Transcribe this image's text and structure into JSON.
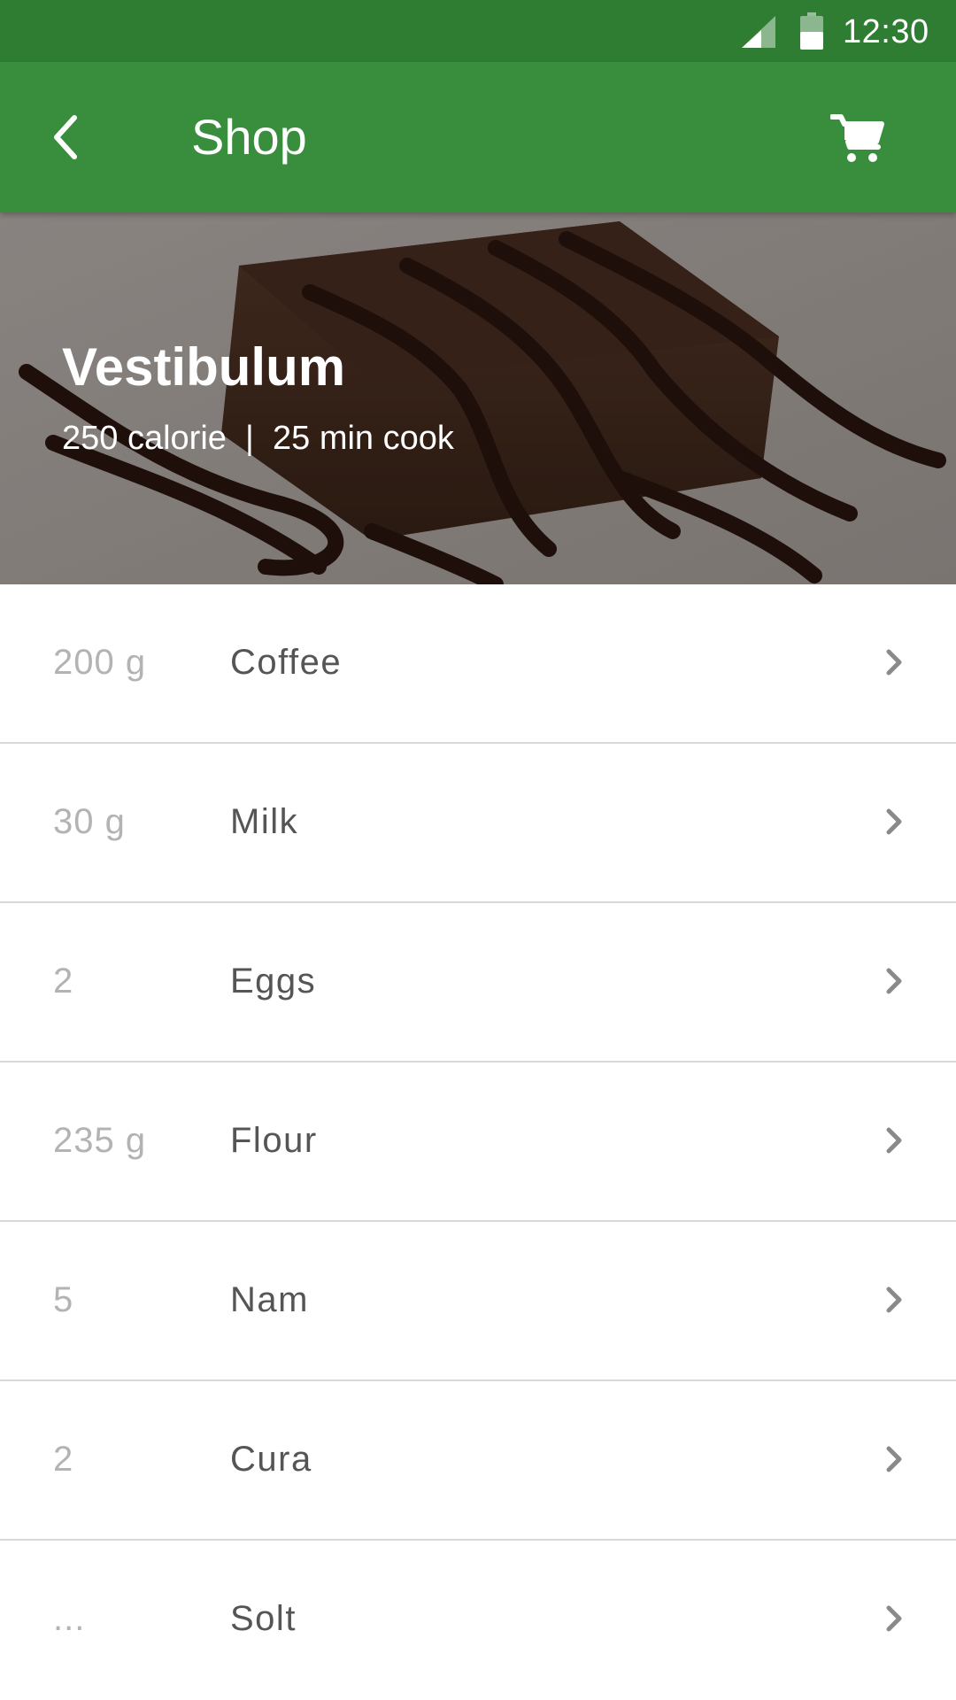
{
  "status_bar": {
    "time": "12:30",
    "signal_icon": "cellular-signal-icon",
    "battery_icon": "battery-icon"
  },
  "app_bar": {
    "back_icon": "arrow-back-icon",
    "title": "Shop",
    "cart_icon": "shopping-cart-icon",
    "background_color": "#388e3c",
    "status_color": "#2e7d32"
  },
  "hero": {
    "title": "Vestibulum",
    "meta": "250 calorie  |  25 min cook"
  },
  "ingredients": [
    {
      "qty": "200 g",
      "name": "Coffee"
    },
    {
      "qty": "30 g",
      "name": "Milk"
    },
    {
      "qty": "2",
      "name": "Eggs"
    },
    {
      "qty": "235 g",
      "name": "Flour"
    },
    {
      "qty": "5",
      "name": "Nam"
    },
    {
      "qty": "2",
      "name": "Cura"
    },
    {
      "qty": "...",
      "name": "Solt"
    }
  ]
}
